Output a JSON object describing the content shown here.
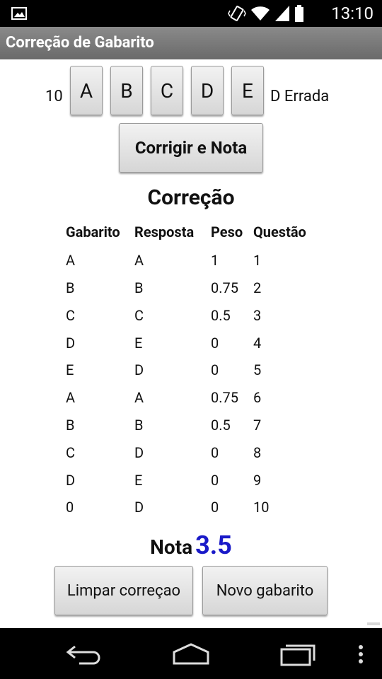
{
  "status_bar": {
    "time": "13:10",
    "icons": [
      "gallery-icon",
      "vibrate-icon",
      "wifi-icon",
      "signal-icon",
      "battery-icon"
    ]
  },
  "app": {
    "title": "Correção de Gabarito"
  },
  "answer_row": {
    "question_number": "10",
    "options": [
      "A",
      "B",
      "C",
      "D",
      "E"
    ],
    "status": "D Errada"
  },
  "buttons": {
    "correct": "Corrigir e Nota",
    "clear": "Limpar correçao",
    "new": "Novo gabarito"
  },
  "section": {
    "title": "Correção"
  },
  "table": {
    "headers": [
      "Gabarito",
      "Resposta",
      "Peso",
      "Questão"
    ],
    "rows": [
      [
        "A",
        "A",
        "1",
        "1"
      ],
      [
        "B",
        "B",
        "0.75",
        "2"
      ],
      [
        "C",
        "C",
        "0.5",
        "3"
      ],
      [
        "D",
        "E",
        "0",
        "4"
      ],
      [
        "E",
        "D",
        "0",
        "5"
      ],
      [
        "A",
        "A",
        "0.75",
        "6"
      ],
      [
        "B",
        "B",
        "0.5",
        "7"
      ],
      [
        "C",
        "D",
        "0",
        "8"
      ],
      [
        "D",
        "E",
        "0",
        "9"
      ],
      [
        "0",
        "D",
        "0",
        "10"
      ]
    ]
  },
  "score": {
    "label": "Nota",
    "value": "3.5",
    "value_color": "#1a1ac8"
  },
  "nav_bar": {
    "icons": [
      "back-icon",
      "home-icon",
      "recents-icon",
      "menu-icon"
    ]
  }
}
